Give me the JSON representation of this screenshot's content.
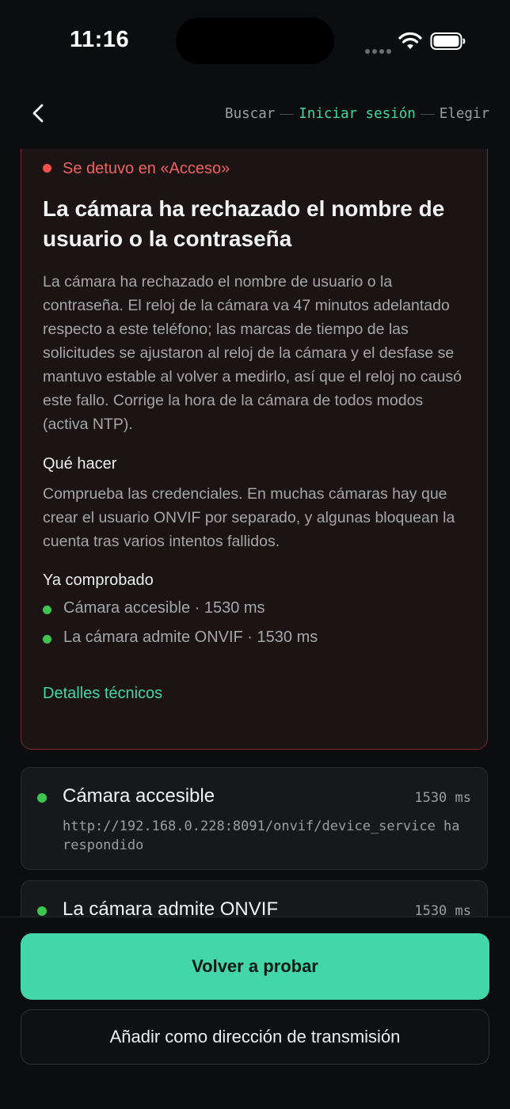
{
  "status_bar": {
    "time": "11:16"
  },
  "nav": {
    "steps": [
      "Buscar",
      "Iniciar sesión",
      "Elegir"
    ],
    "active_step": "Iniciar sesión"
  },
  "error_card": {
    "status": "Se detuvo en «Acceso»",
    "title": "La cámara ha rechazado el nombre de usuario o la contraseña",
    "body": "La cámara ha rechazado el nombre de usuario o la contraseña. El reloj de la cámara va 47 minutos adelantado respecto a este teléfono; las marcas de tiempo de las solicitudes se ajustaron al reloj de la cámara y el desfase se mantuvo estable al volver a medirlo, así que el reloj no causó este fallo. Corrige la hora de la cámara de todos modos (activa NTP).",
    "what_to_do_heading": "Qué hacer",
    "what_to_do_body": "Comprueba las credenciales. En muchas cámaras hay que crear el usuario ONVIF por separado, y algunas bloquean la cuenta tras varios intentos fallidos.",
    "checked_heading": "Ya comprobado",
    "checked_items": [
      "Cámara accesible · 1530 ms",
      "La cámara admite ONVIF · 1530 ms"
    ],
    "details_link": "Detalles técnicos"
  },
  "step_cards": [
    {
      "title": "Cámara accesible",
      "time": "1530 ms",
      "description": "http://192.168.0.228:8091/onvif/device_service ha respondido"
    },
    {
      "title": "La cámara admite ONVIF",
      "time": "1530 ms"
    }
  ],
  "buttons": {
    "retry": "Volver a probar",
    "add_stream": "Añadir como dirección de transmisión"
  },
  "colors": {
    "accent": "#43d6a8",
    "error": "#f0625f",
    "success": "#3ec451",
    "background": "#0c0d0f"
  },
  "icons": [
    "chevron-left-icon",
    "cellular-signal-icon",
    "wifi-icon",
    "battery-icon"
  ]
}
